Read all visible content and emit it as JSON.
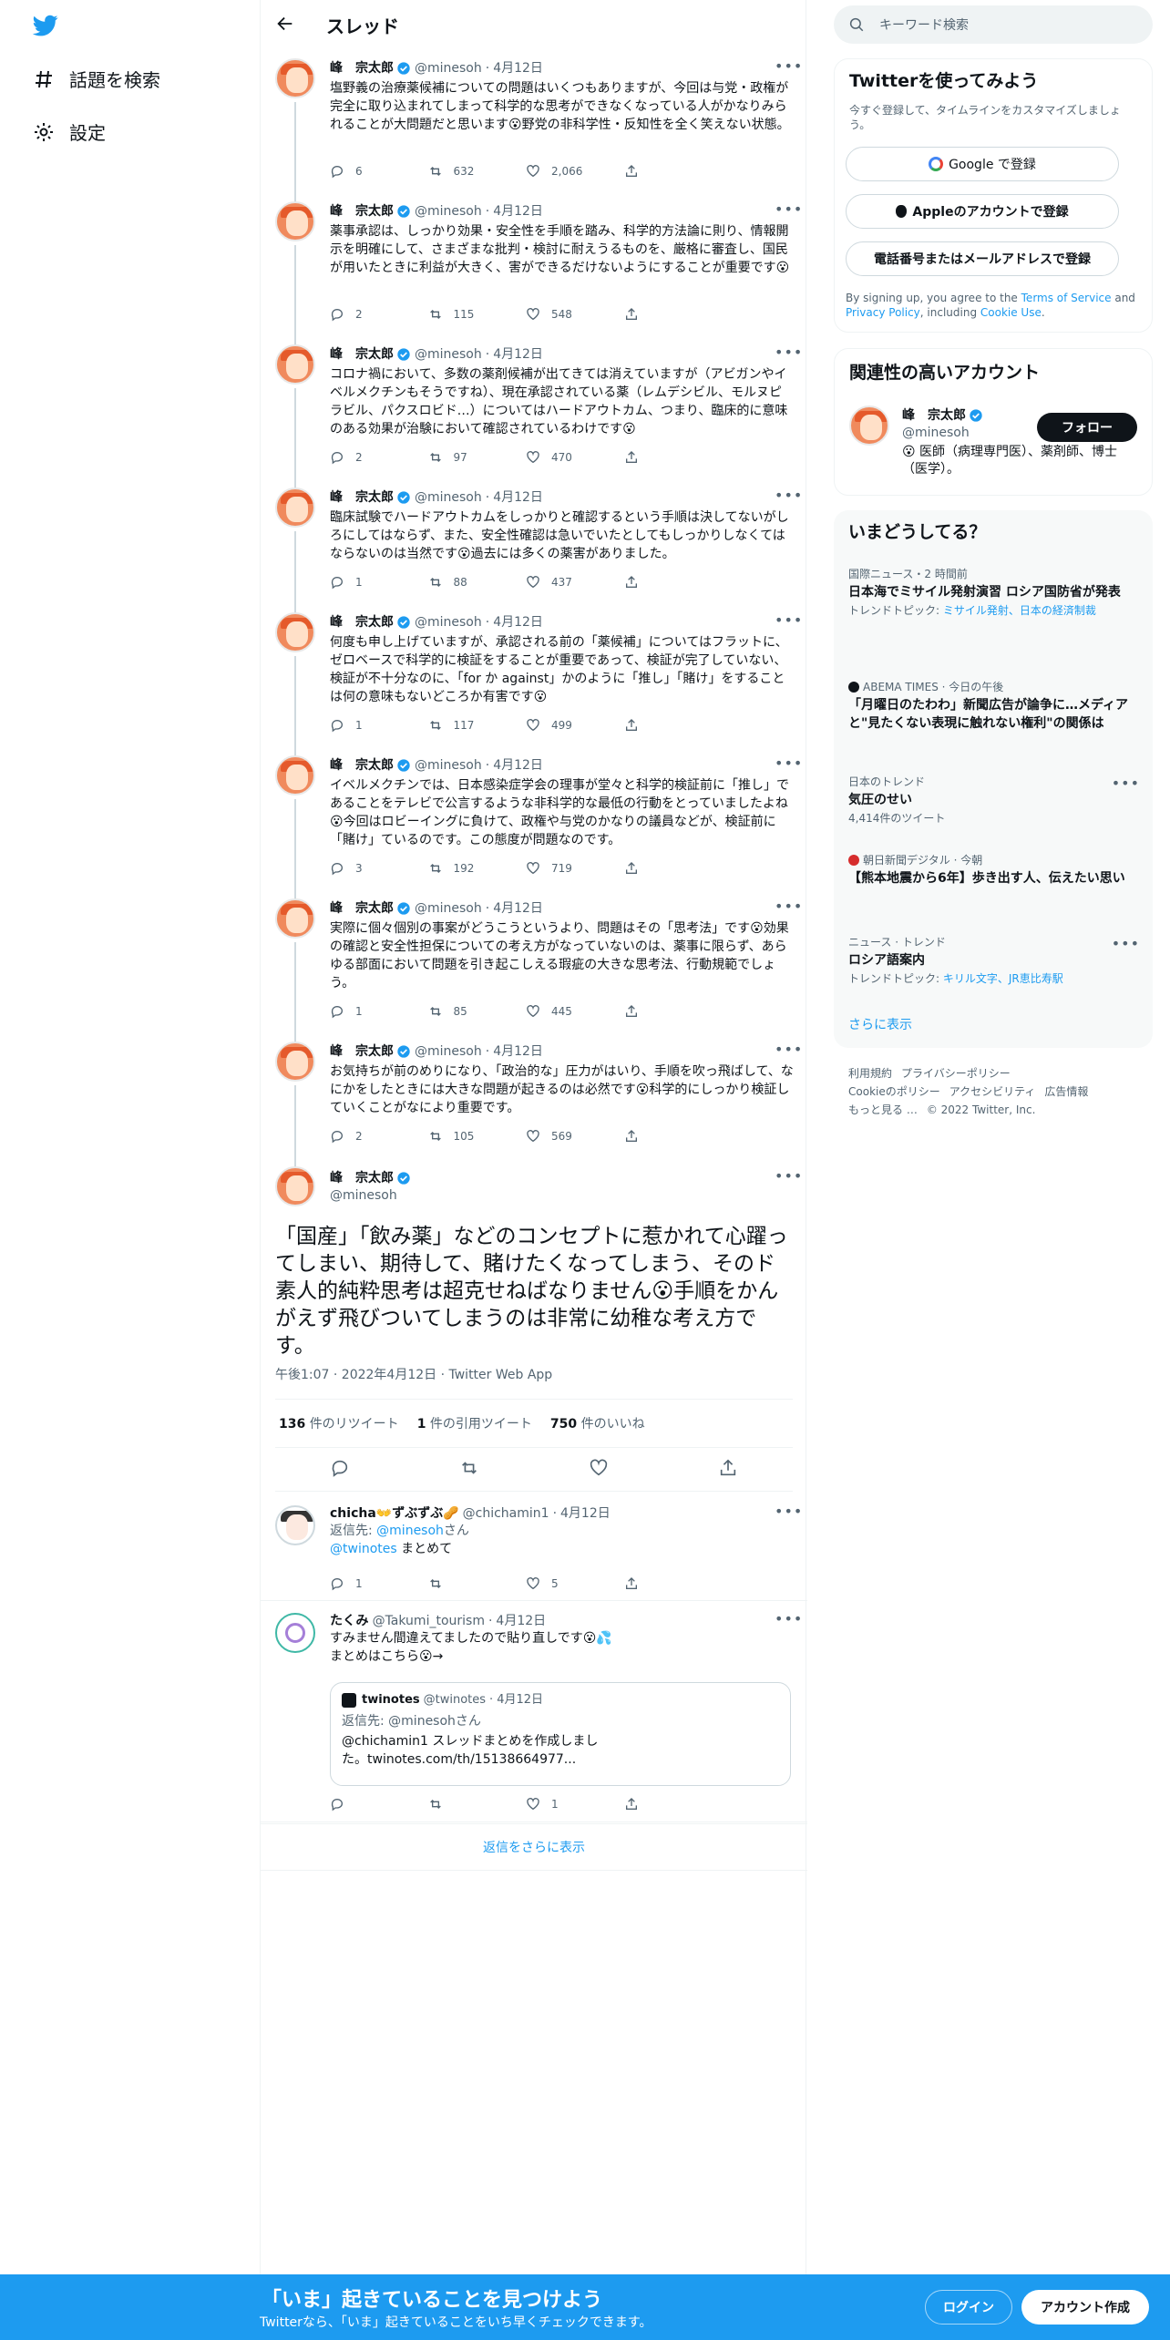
{
  "nav": {
    "explore": "話題を検索",
    "settings": "設定"
  },
  "header": {
    "title": "スレッド"
  },
  "author": {
    "name": "峰　宗太郎",
    "handle": "@minesoh",
    "date": "4月12日"
  },
  "tweets": [
    {
      "text": "塩野義の治療薬候補についての問題はいくつもありますが、今回は与党・政権が完全に取り込まれてしまって科学的な思考ができなくなっている人がかなりみられることが大問題だと思います😮野党の非科学性・反知性を全く笑えない状態。",
      "replies": "6",
      "retweets": "632",
      "likes": "2,066"
    },
    {
      "text": "薬事承認は、しっかり効果・安全性を手順を踏み、科学的方法論に則り、情報開示を明確にして、さまざまな批判・検討に耐えうるものを、厳格に審査し、国民が用いたときに利益が大きく、害ができるだけないようにすることが重要です😮",
      "replies": "2",
      "retweets": "115",
      "likes": "548"
    },
    {
      "text": "コロナ禍において、多数の薬剤候補が出てきては消えていますが（アビガンやイベルメクチンもそうですね）、現在承認されている薬（レムデシビル、モルヌピラビル、パクスロビド…）についてはハードアウトカム、つまり、臨床的に意味のある効果が治験において確認されているわけです😮",
      "replies": "2",
      "retweets": "97",
      "likes": "470"
    },
    {
      "text": "臨床試験でハードアウトカムをしっかりと確認するという手順は決してないがしろにしてはならず、また、安全性確認は急いでいたとしてもしっかりしなくてはならないのは当然です😮過去には多くの薬害がありました。",
      "replies": "1",
      "retweets": "88",
      "likes": "437"
    },
    {
      "text": "何度も申し上げていますが、承認される前の「薬候補」についてはフラットに、ゼロベースで科学的に検証をすることが重要であって、検証が完了していない、検証が不十分なのに、「for か against」かのように「推し」「賭け」をすることは何の意味もないどころか有害です😮",
      "replies": "1",
      "retweets": "117",
      "likes": "499"
    },
    {
      "text": "イベルメクチンでは、日本感染症学会の理事が堂々と科学的検証前に「推し」であることをテレビで公言するような非科学的な最低の行動をとっていましたよね😮今回はロビーイングに負けて、政権や与党のかなりの議員などが、検証前に「賭け」ているのです。この態度が問題なのです。",
      "replies": "3",
      "retweets": "192",
      "likes": "719"
    },
    {
      "text": "実際に個々個別の事案がどうこうというより、問題はその「思考法」です😮効果の確認と安全性担保についての考え方がなっていないのは、薬事に限らず、あらゆる部面において問題を引き起こしえる瑕疵の大きな思考法、行動規範でしょう。",
      "replies": "1",
      "retweets": "85",
      "likes": "445"
    },
    {
      "text": "お気持ちが前のめりになり、「政治的な」圧力がはいり、手順を吹っ飛ばして、なにかをしたときには大きな問題が起きるのは必然です😮科学的にしっかり検証していくことがなにより重要です。",
      "replies": "2",
      "retweets": "105",
      "likes": "569"
    }
  ],
  "main_tweet": {
    "name": "峰　宗太郎",
    "handle": "@minesoh",
    "text": "「国産」「飲み薬」などのコンセプトに惹かれて心躍ってしまい、期待して、賭けたくなってしまう、そのド素人的純粋思考は超克せねばなりません😮手順をかんがえず飛びついてしまうのは非常に幼稚な考え方です。",
    "timestamp": "午後1:07 · 2022年4月12日 · Twitter Web App",
    "retweets_num": "136",
    "retweets_label": "件のリツイート",
    "quotes_num": "1",
    "quotes_label": "件の引用ツイート",
    "likes_num": "750",
    "likes_label": "件のいいね"
  },
  "reply1": {
    "name": "chicha👐ずぶずぶ🥜",
    "handle": "@chichamin1",
    "date": "4月12日",
    "reply_to_prefix": "返信先: ",
    "reply_to": "@minesoh",
    "reply_to_suffix": "さん",
    "mention": "@twinotes",
    "text": " まとめて",
    "replies": "1",
    "retweets": "",
    "likes": "5"
  },
  "reply2": {
    "name": "たくみ",
    "handle": "@Takumi_tourism",
    "date": "4月12日",
    "text1": "すみません間違えてましたので貼り直しです😮💦",
    "text2": "まとめはこちら😮→",
    "quote": {
      "name": "twinotes",
      "handle": "@twinotes",
      "date": "4月12日",
      "reply_to": "返信先: @minesohさん",
      "text": "@chichamin1 スレッドまとめを作成しました。twinotes.com/th/15138664977..."
    },
    "likes": "1"
  },
  "show_more": "返信をさらに表示",
  "search": {
    "placeholder": "キーワード検索"
  },
  "signup_card": {
    "title": "Twitterを使ってみよう",
    "subtitle": "今すぐ登録して、タイムラインをカスタマイズしましょう。",
    "google": "Google で登録",
    "apple": "Appleのアカウントで登録",
    "phone": "電話番号またはメールアドレスで登録",
    "terms_prefix": "By signing up, you agree to the ",
    "terms_link": "Terms of Service",
    "terms_and": " and ",
    "privacy_link": "Privacy Policy",
    "terms_incl": ", including ",
    "cookie_link": "Cookie Use",
    "terms_end": "."
  },
  "related": {
    "title": "関連性の高いアカウント",
    "name": "峰　宗太郎",
    "handle": "@minesoh",
    "bio": "😮 医師（病理専門医）、薬剤師、博士（医学）。",
    "follow": "フォロー"
  },
  "trends": {
    "title": "いまどうしてる？",
    "items": [
      {
        "meta": "国際ニュース・2 時間前",
        "title": "日本海でミサイル発射演習 ロシア国防省が発表",
        "sub_prefix": "トレンドトピック: ",
        "sub_link": "ミサイル発射、日本の経済制裁"
      },
      {
        "meta": "ABEMA TIMES · 今日の午後",
        "title": "「月曜日のたわわ」新聞広告が論争に…メディアと\"見たくない表現に触れない権利\"の関係は"
      },
      {
        "meta": "日本のトレンド",
        "title": "気圧のせい",
        "sub": "4,414件のツイート"
      },
      {
        "meta": "朝日新聞デジタル · 今朝",
        "title": "【熊本地震から6年】歩き出す人、伝えたい思い"
      },
      {
        "meta": "ニュース · トレンド",
        "title": "ロシア語案内",
        "sub_prefix": "トレンドトピック: ",
        "sub_link": "キリル文字、JR恵比寿駅"
      }
    ],
    "show_more": "さらに表示"
  },
  "footer": {
    "terms": "利用規約",
    "privacy": "プライバシーポリシー",
    "cookie": "Cookieのポリシー",
    "accessibility": "アクセシビリティ",
    "ads": "広告情報",
    "more": "もっと見る …",
    "copyright": "© 2022 Twitter, Inc."
  },
  "bottom_bar": {
    "title": "「いま」起きていることを見つけよう",
    "subtitle": "Twitterなら、「いま」起きていることをいち早くチェックできます。",
    "login": "ログイン",
    "signup": "アカウント作成"
  },
  "colors": {
    "accent": "#1d9bf0",
    "text": "#0f1419",
    "muted": "#536471"
  }
}
